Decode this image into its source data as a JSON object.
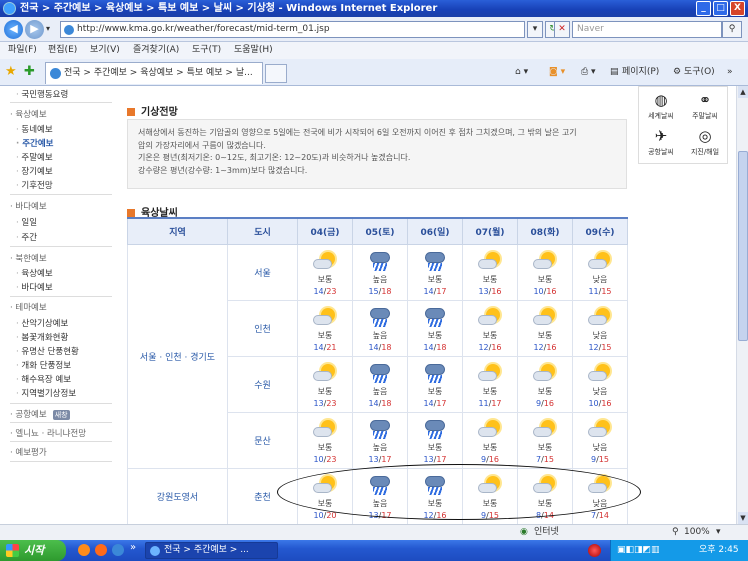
{
  "window": {
    "title": "전국 > 주간예보 > 육상예보 > 특보 예보 > 날씨 > 기상청 - Windows Internet Explorer",
    "min": "_",
    "max": "□",
    "close": "X"
  },
  "address": {
    "url": "http://www.kma.go.kr/weather/forecast/mid-term_01.jsp",
    "search_placeholder": "Naver"
  },
  "menu": [
    "파일(F)",
    "편집(E)",
    "보기(V)",
    "즐겨찾기(A)",
    "도구(T)",
    "도움말(H)"
  ],
  "tab": {
    "label": "전국 > 주간예보 > 육상예보 > 특보 예보 > 날..."
  },
  "commands": {
    "page": "페이지(P)",
    "tools": "도구(O)"
  },
  "sidebar": [
    {
      "label": "국민행동요령",
      "type": "sub"
    },
    {
      "label": "육상예보",
      "type": "sec"
    },
    {
      "label": "동네예보",
      "type": "sub"
    },
    {
      "label": "주간예보",
      "type": "sub"
    },
    {
      "label": "주말예보",
      "type": "sub"
    },
    {
      "label": "장기예보",
      "type": "sub"
    },
    {
      "label": "기후전망",
      "type": "sub"
    },
    {
      "label": "바다예보",
      "type": "sec"
    },
    {
      "label": "일일",
      "type": "sub"
    },
    {
      "label": "주간",
      "type": "sub"
    },
    {
      "label": "북한예보",
      "type": "sec"
    },
    {
      "label": "육상예보",
      "type": "sub"
    },
    {
      "label": "바다예보",
      "type": "sub"
    },
    {
      "label": "테마예보",
      "type": "sec"
    },
    {
      "label": "산악기상예보",
      "type": "sub"
    },
    {
      "label": "봄꽃개화현황",
      "type": "sub"
    },
    {
      "label": "유명산 단풍현황",
      "type": "sub"
    },
    {
      "label": "개화 단풍정보",
      "type": "sub"
    },
    {
      "label": "해수욕장 예보",
      "type": "sub"
    },
    {
      "label": "지역별기상정보",
      "type": "sub"
    },
    {
      "label": "공항예보",
      "type": "sec",
      "badge": "새창"
    },
    {
      "label": "엘니뇨 · 라니냐전망",
      "type": "sec"
    },
    {
      "label": "예보평가",
      "type": "sec"
    }
  ],
  "forecast": {
    "title": "기상전망",
    "lines": [
      "서해상에서 동진하는 기압골의 영향으로 5일에는 전국에 비가 시작되어 6일 오전까지 이어진 후 점차 그치겠으며, 그 밖의 날은 고기",
      "압의 가장자리에서 구름이 많겠습니다.",
      "기온은 평년(최저기온: 0~12도, 최고기온: 12~20도)과 비슷하거나 높겠습니다.",
      "강수량은 평년(강수량: 1~3mm)보다 많겠습니다."
    ]
  },
  "land": {
    "title": "육상날씨",
    "col_region": "지역",
    "col_city": "도시",
    "days": [
      "04(금)",
      "05(토)",
      "06(일)",
      "07(월)",
      "08(화)",
      "09(수)"
    ],
    "regions": [
      {
        "name": "서울 · 인천 · 경기도",
        "cities": [
          {
            "name": "서울",
            "days": [
              {
                "icon": "partly-cloudy-icon",
                "cond": "보통",
                "min": "14",
                "max": "23"
              },
              {
                "icon": "rain-icon",
                "cond": "높음",
                "min": "15",
                "max": "18"
              },
              {
                "icon": "rain-icon",
                "cond": "보통",
                "min": "14",
                "max": "17"
              },
              {
                "icon": "partly-cloudy-icon",
                "cond": "보통",
                "min": "13",
                "max": "16"
              },
              {
                "icon": "partly-cloudy-icon",
                "cond": "보통",
                "min": "10",
                "max": "16"
              },
              {
                "icon": "partly-cloudy-icon",
                "cond": "낮음",
                "min": "11",
                "max": "15"
              }
            ]
          },
          {
            "name": "인천",
            "days": [
              {
                "icon": "partly-cloudy-icon",
                "cond": "보통",
                "min": "14",
                "max": "21"
              },
              {
                "icon": "rain-icon",
                "cond": "높음",
                "min": "14",
                "max": "18"
              },
              {
                "icon": "rain-icon",
                "cond": "보통",
                "min": "14",
                "max": "18"
              },
              {
                "icon": "partly-cloudy-icon",
                "cond": "보통",
                "min": "12",
                "max": "16"
              },
              {
                "icon": "partly-cloudy-icon",
                "cond": "보통",
                "min": "12",
                "max": "16"
              },
              {
                "icon": "partly-cloudy-icon",
                "cond": "낮음",
                "min": "12",
                "max": "15"
              }
            ]
          },
          {
            "name": "수원",
            "days": [
              {
                "icon": "partly-cloudy-icon",
                "cond": "보통",
                "min": "13",
                "max": "23"
              },
              {
                "icon": "rain-icon",
                "cond": "높음",
                "min": "14",
                "max": "18"
              },
              {
                "icon": "rain-icon",
                "cond": "보통",
                "min": "14",
                "max": "17"
              },
              {
                "icon": "partly-cloudy-icon",
                "cond": "보통",
                "min": "11",
                "max": "17"
              },
              {
                "icon": "partly-cloudy-icon",
                "cond": "보통",
                "min": "9",
                "max": "16"
              },
              {
                "icon": "partly-cloudy-icon",
                "cond": "낮음",
                "min": "10",
                "max": "16"
              }
            ]
          },
          {
            "name": "문산",
            "days": [
              {
                "icon": "partly-cloudy-icon",
                "cond": "보통",
                "min": "10",
                "max": "23"
              },
              {
                "icon": "rain-icon",
                "cond": "높음",
                "min": "13",
                "max": "17"
              },
              {
                "icon": "rain-icon",
                "cond": "보통",
                "min": "13",
                "max": "17"
              },
              {
                "icon": "partly-cloudy-icon",
                "cond": "보통",
                "min": "9",
                "max": "16"
              },
              {
                "icon": "partly-cloudy-icon",
                "cond": "보통",
                "min": "7",
                "max": "15"
              },
              {
                "icon": "partly-cloudy-icon",
                "cond": "낮음",
                "min": "9",
                "max": "15"
              }
            ]
          }
        ]
      },
      {
        "name": "강원도영서",
        "cities": [
          {
            "name": "춘천",
            "days": [
              {
                "icon": "partly-cloudy-icon",
                "cond": "보통",
                "min": "10",
                "max": "20"
              },
              {
                "icon": "rain-icon",
                "cond": "높음",
                "min": "13",
                "max": "17"
              },
              {
                "icon": "rain-icon",
                "cond": "보통",
                "min": "12",
                "max": "16"
              },
              {
                "icon": "partly-cloudy-icon",
                "cond": "보통",
                "min": "9",
                "max": "15"
              },
              {
                "icon": "partly-cloudy-icon",
                "cond": "보통",
                "min": "8",
                "max": "14"
              },
              {
                "icon": "partly-cloudy-icon",
                "cond": "낮음",
                "min": "7",
                "max": "14"
              }
            ]
          }
        ]
      }
    ]
  },
  "quicklinks": [
    "세계날씨",
    "주말날씨",
    "공항날씨",
    "지진/해일"
  ],
  "status": {
    "zone": "인터넷",
    "zoom": "100%"
  },
  "taskbar": {
    "start": "시작",
    "item": "전국 > 주간예보 > ...",
    "clock": "오후 2:45"
  }
}
